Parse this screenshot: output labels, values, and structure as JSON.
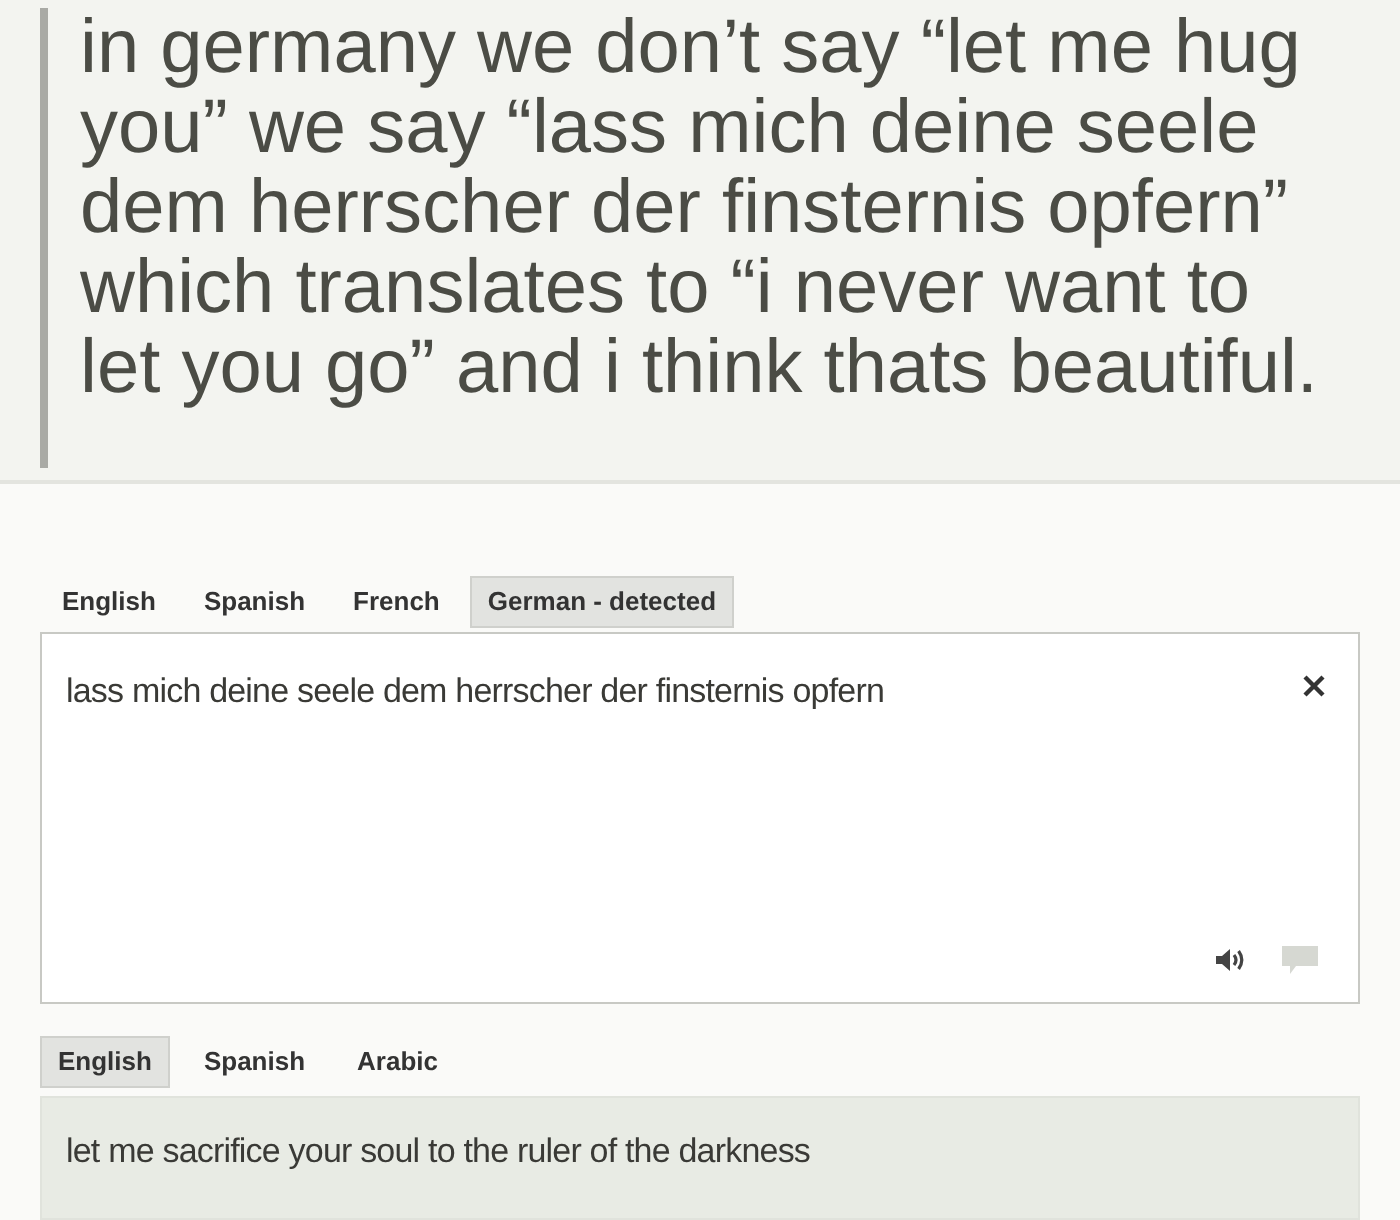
{
  "post": {
    "text": "in germany we don’t say “let me hug you” we say “lass mich deine seele dem herrscher der finsternis opfern” which translates to “i never want to let you go” and i think thats beautiful."
  },
  "source": {
    "tabs": [
      {
        "label": "English",
        "selected": false
      },
      {
        "label": "Spanish",
        "selected": false
      },
      {
        "label": "French",
        "selected": false
      },
      {
        "label": "German - detected",
        "selected": true
      }
    ],
    "value": "lass mich deine seele dem herrscher der finsternis opfern"
  },
  "target": {
    "tabs": [
      {
        "label": "English",
        "selected": true
      },
      {
        "label": "Spanish",
        "selected": false
      },
      {
        "label": "Arabic",
        "selected": false
      }
    ],
    "text": "let me sacrifice your soul to the ruler of the darkness"
  }
}
